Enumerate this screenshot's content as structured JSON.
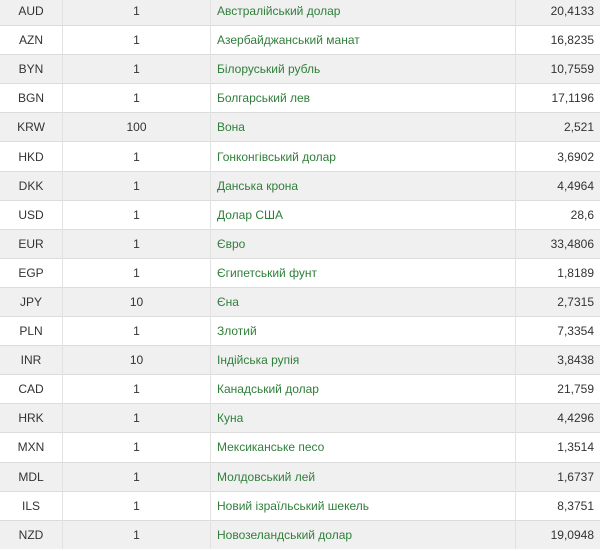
{
  "rates": [
    {
      "code": "AUD",
      "units": "1",
      "name": "Австралійський долар",
      "rate": "20,4133"
    },
    {
      "code": "AZN",
      "units": "1",
      "name": "Азербайджанський манат",
      "rate": "16,8235"
    },
    {
      "code": "BYN",
      "units": "1",
      "name": "Білоруський рубль",
      "rate": "10,7559"
    },
    {
      "code": "BGN",
      "units": "1",
      "name": "Болгарський лев",
      "rate": "17,1196"
    },
    {
      "code": "KRW",
      "units": "100",
      "name": "Вона",
      "rate": "2,521"
    },
    {
      "code": "HKD",
      "units": "1",
      "name": "Гонконгівський долар",
      "rate": "3,6902"
    },
    {
      "code": "DKK",
      "units": "1",
      "name": "Данська крона",
      "rate": "4,4964"
    },
    {
      "code": "USD",
      "units": "1",
      "name": "Долар США",
      "rate": "28,6"
    },
    {
      "code": "EUR",
      "units": "1",
      "name": "Євро",
      "rate": "33,4806"
    },
    {
      "code": "EGP",
      "units": "1",
      "name": "Єгипетський фунт",
      "rate": "1,8189"
    },
    {
      "code": "JPY",
      "units": "10",
      "name": "Єна",
      "rate": "2,7315"
    },
    {
      "code": "PLN",
      "units": "1",
      "name": "Злотий",
      "rate": "7,3354"
    },
    {
      "code": "INR",
      "units": "10",
      "name": "Індійська рупія",
      "rate": "3,8438"
    },
    {
      "code": "CAD",
      "units": "1",
      "name": "Канадський долар",
      "rate": "21,759"
    },
    {
      "code": "HRK",
      "units": "1",
      "name": "Куна",
      "rate": "4,4296"
    },
    {
      "code": "MXN",
      "units": "1",
      "name": "Мексиканське песо",
      "rate": "1,3514"
    },
    {
      "code": "MDL",
      "units": "1",
      "name": "Молдовський лей",
      "rate": "1,6737"
    },
    {
      "code": "ILS",
      "units": "1",
      "name": "Новий ізраїльський шекель",
      "rate": "8,3751"
    },
    {
      "code": "NZD",
      "units": "1",
      "name": "Новозеландський долар",
      "rate": "19,0948"
    }
  ],
  "colors": {
    "link": "#2f7f3a",
    "row_odd": "#f0f0f0",
    "row_even": "#ffffff",
    "border": "#dcdcdc"
  }
}
